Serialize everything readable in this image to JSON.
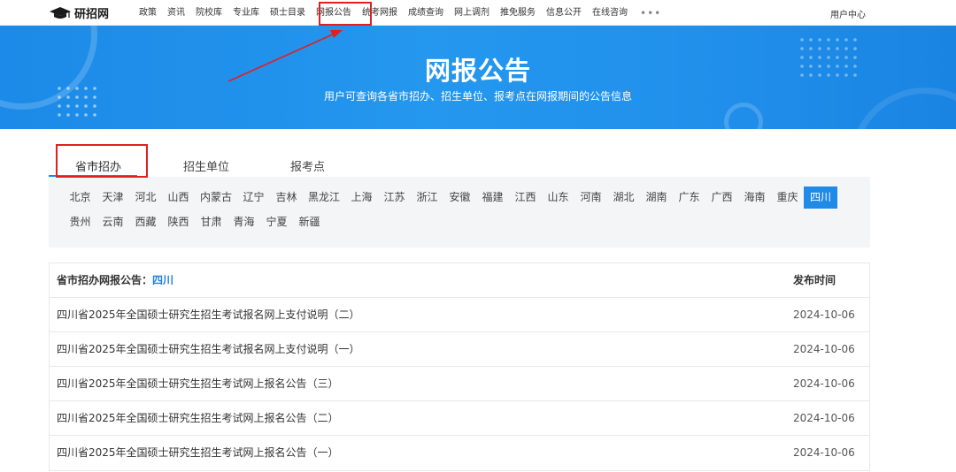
{
  "nav": {
    "logo_text": "研招网",
    "items": [
      "政策",
      "资讯",
      "院校库",
      "专业库",
      "硕士目录",
      "网报公告",
      "统考网报",
      "成绩查询",
      "网上调剂",
      "推免服务",
      "信息公开",
      "在线咨询"
    ],
    "more": "•••",
    "user_center": "用户中心"
  },
  "banner": {
    "title": "网报公告",
    "subtitle": "用户可查询各省市招办、招生单位、报考点在网报期间的公告信息"
  },
  "tabs": [
    "省市招办",
    "招生单位",
    "报考点"
  ],
  "provinces": {
    "row1": [
      "北京",
      "天津",
      "河北",
      "山西",
      "内蒙古",
      "辽宁",
      "吉林",
      "黑龙江",
      "上海",
      "江苏",
      "浙江",
      "安徽",
      "福建",
      "江西",
      "山东",
      "河南",
      "湖北",
      "湖南",
      "广东",
      "广西",
      "海南",
      "重庆",
      "四川"
    ],
    "row2": [
      "贵州",
      "云南",
      "西藏",
      "陕西",
      "甘肃",
      "青海",
      "宁夏",
      "新疆"
    ],
    "selected": "四川"
  },
  "table": {
    "header_label": "省市招办网报公告：",
    "header_region": "四川",
    "date_header": "发布时间",
    "rows": [
      {
        "title": "四川省2025年全国硕士研究生招生考试报名网上支付说明（二）",
        "date": "2024-10-06"
      },
      {
        "title": "四川省2025年全国硕士研究生招生考试报名网上支付说明（一）",
        "date": "2024-10-06"
      },
      {
        "title": "四川省2025年全国硕士研究生招生考试网上报名公告（三）",
        "date": "2024-10-06"
      },
      {
        "title": "四川省2025年全国硕士研究生招生考试网上报名公告（二）",
        "date": "2024-10-06"
      },
      {
        "title": "四川省2025年全国硕士研究生招生考试网上报名公告（一）",
        "date": "2024-10-06"
      }
    ]
  },
  "colors": {
    "accent": "#1f8ae8",
    "annotation": "#e02020"
  }
}
